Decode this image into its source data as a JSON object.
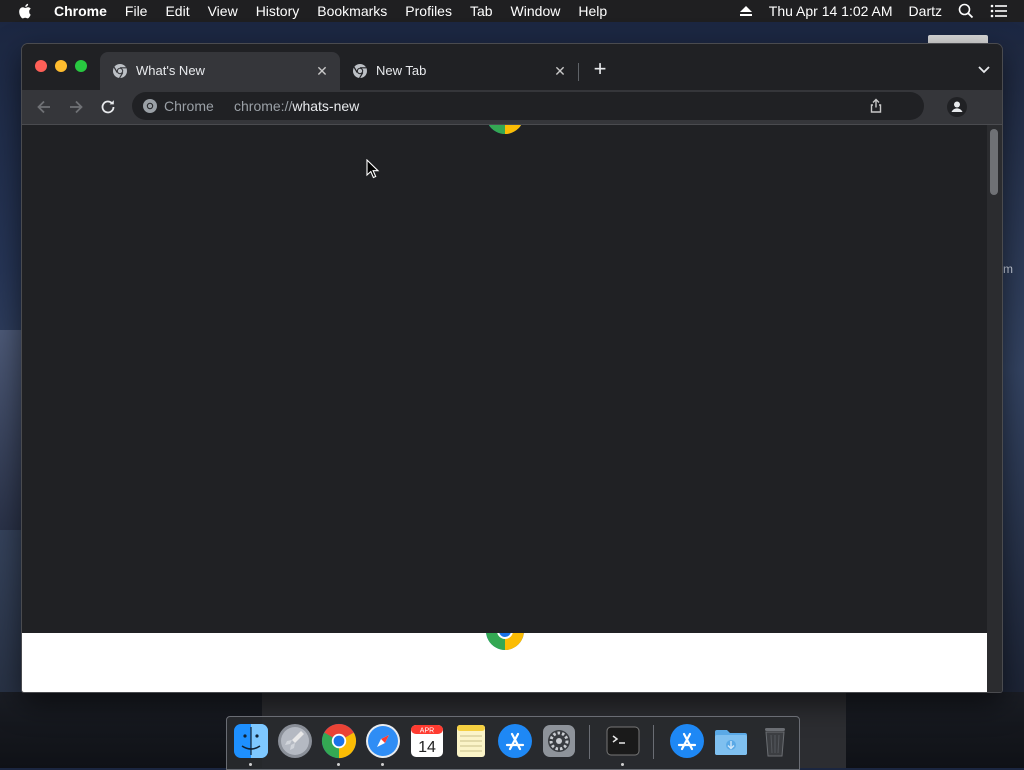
{
  "menubar": {
    "app_name": "Chrome",
    "items": [
      "File",
      "Edit",
      "View",
      "History",
      "Bookmarks",
      "Profiles",
      "Tab",
      "Window",
      "Help"
    ],
    "datetime": "Thu Apr 14  1:02 AM",
    "user": "Dartz"
  },
  "tabs": [
    {
      "title": "What's New",
      "active": true
    },
    {
      "title": "New Tab",
      "active": false
    }
  ],
  "omnibox": {
    "chip": "Chrome",
    "url_scheme": "chrome://",
    "url_host": "whats-new"
  },
  "desktop": {
    "partial_text": "m"
  },
  "dock": {
    "items": [
      "Finder",
      "Launchpad",
      "Google Chrome",
      "Safari",
      "Calendar",
      "Notes",
      "App Store",
      "System Preferences",
      "Terminal",
      "Applications",
      "Downloads",
      "Trash"
    ],
    "calendar_month": "APR",
    "calendar_day": "14"
  },
  "colors": {
    "chrome_dark_bg": "#202124",
    "toolbar_bg": "#35363a",
    "traffic_close": "#fe5f57",
    "traffic_min": "#febc2e",
    "traffic_max": "#28c840"
  }
}
